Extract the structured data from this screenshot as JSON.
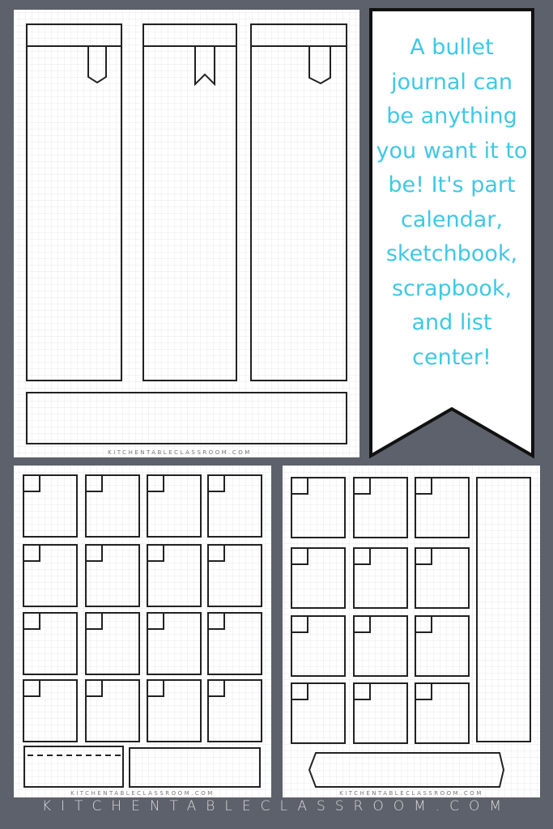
{
  "banner": {
    "text": "A bullet journal can be anything you want it to be! It's part calendar, sketchbook, scrapbook, and list center!",
    "text_color": "#3fc8e4"
  },
  "watermarks": {
    "top": "KITCHENTABLECLASSROOM.COM",
    "bottom_left": "KITCHENTABLECLASSROOM.COM",
    "bottom_right": "KITCHENTABLECLASSROOM.COM"
  },
  "footer": {
    "text": "KITCHENTABLECLASSROOM.COM"
  },
  "colors": {
    "background": "#5c616b",
    "page": "#ffffff",
    "grid": "#e3e3e3",
    "ink": "#222222"
  }
}
